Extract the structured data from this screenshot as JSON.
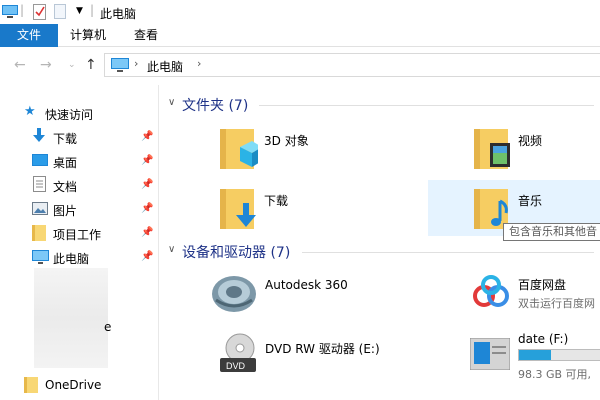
{
  "titlebar": {
    "title": "此电脑"
  },
  "ribbon": {
    "tabs": [
      {
        "label": "文件"
      },
      {
        "label": "计算机"
      },
      {
        "label": "查看"
      }
    ]
  },
  "address": {
    "location": "此电脑"
  },
  "sidebar": {
    "items": [
      {
        "label": "快速访问",
        "icon": "star-icon"
      },
      {
        "label": "下载",
        "icon": "download-arrow-icon",
        "pinned": true
      },
      {
        "label": "桌面",
        "icon": "desktop-icon",
        "pinned": true
      },
      {
        "label": "文档",
        "icon": "document-icon",
        "pinned": true
      },
      {
        "label": "图片",
        "icon": "picture-icon",
        "pinned": true
      },
      {
        "label": "项目工作",
        "icon": "folder-icon",
        "pinned": true
      },
      {
        "label": "此电脑",
        "icon": "computer-icon",
        "pinned": true
      },
      {
        "label": "OneDrive",
        "icon": "folder-icon"
      }
    ],
    "partial_text": "e"
  },
  "folders_section": {
    "title": "文件夹 (7)"
  },
  "folders": [
    {
      "label": "3D 对象",
      "icon": "3d-objects-folder-icon"
    },
    {
      "label": "视频",
      "icon": "video-folder-icon"
    },
    {
      "label": "下载",
      "icon": "download-folder-icon"
    },
    {
      "label": "音乐",
      "icon": "music-folder-icon"
    }
  ],
  "tooltip": {
    "text": "包含音乐和其他音"
  },
  "devices_section": {
    "title": "设备和驱动器 (7)"
  },
  "devices": [
    {
      "label": "Autodesk 360",
      "icon": "autodesk-360-icon"
    },
    {
      "label": "百度网盘",
      "sub": "双击运行百度网",
      "icon": "baidu-netdisk-icon"
    },
    {
      "label": "DVD RW 驱动器 (E:)",
      "icon": "dvd-drive-icon"
    },
    {
      "label": "date (F:)",
      "sub": "98.3 GB 可用,",
      "icon": "drive-icon",
      "usage_fraction": 0.36
    }
  ],
  "colors": {
    "accent": "#1979ca",
    "section_title": "#1e3287",
    "selection": "#e5f3ff",
    "bar_fill": "#26a0da"
  }
}
